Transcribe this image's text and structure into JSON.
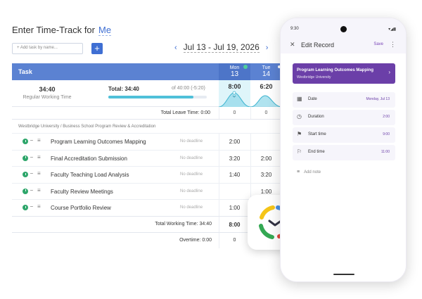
{
  "header": {
    "title": "Enter Time-Track for",
    "user": "Me"
  },
  "add_task": {
    "placeholder": "+ Add task by name...",
    "button": "+"
  },
  "date_nav": {
    "prev": "‹",
    "range": "Jul 13 - Jul 19, 2026",
    "next": "›"
  },
  "table": {
    "task_header": "Task",
    "days": [
      {
        "name": "Mon",
        "date": "13"
      },
      {
        "name": "Tue",
        "date": "14"
      }
    ],
    "summary": {
      "regular_time": "34:40",
      "regular_label": "Regular Working Time",
      "total": "Total: 34:40",
      "of": "of 40:00 (-5:20)",
      "progress": 0.867,
      "mon": "8:00",
      "tue": "6:20"
    },
    "leave": {
      "label": "Total Leave Time: 0:00",
      "mon": "0",
      "tue": "0"
    },
    "project": "Westbridge University / Business School Program Review & Accreditation",
    "rows": [
      {
        "name": "Program Learning Outcomes Mapping",
        "deadline": "No deadline",
        "mon": "2:00",
        "tue": ""
      },
      {
        "name": "Final Accreditation Submission",
        "deadline": "No deadline",
        "mon": "3:20",
        "tue": "2:00"
      },
      {
        "name": "Faculty Teaching Load Analysis",
        "deadline": "No deadline",
        "mon": "1:40",
        "tue": "3:20"
      },
      {
        "name": "Faculty Review Meetings",
        "deadline": "No deadline",
        "mon": "",
        "tue": "1:00"
      },
      {
        "name": "Course Portfolio Review",
        "deadline": "No deadline",
        "mon": "1:00",
        "tue": ""
      }
    ],
    "total_working": {
      "label": "Total Working Time: 34:40",
      "mon": "8:00"
    },
    "overtime": {
      "label": "Overtime: 0:00",
      "mon": "0"
    }
  },
  "phone": {
    "time": "9:30",
    "status": "▾◢▮",
    "title": "Edit Record",
    "save": "Save",
    "task_name": "Program Learning Outcomes Mapping",
    "task_org": "Westbridge University",
    "fields": [
      {
        "label": "Date",
        "value": "Monday, Jul 13"
      },
      {
        "label": "Duration",
        "value": "2:00"
      },
      {
        "label": "Start time",
        "value": "9:00"
      },
      {
        "label": "End time",
        "value": "11:00"
      }
    ],
    "add_note": "Add note"
  },
  "colors": {
    "accent": "#3f6fd3",
    "purple": "#6b3fa8",
    "teal": "#4fc0d9",
    "green": "#2ea66b"
  }
}
